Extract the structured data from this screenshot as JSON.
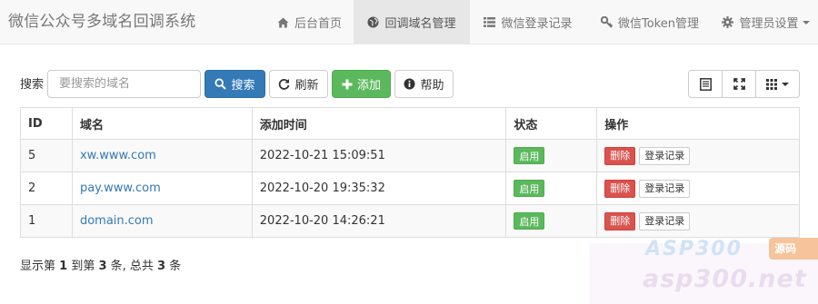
{
  "navbar": {
    "brand": "微信公众号多域名回调系统",
    "items": [
      {
        "label": "后台首页",
        "icon": "home-icon",
        "active": false
      },
      {
        "label": "回调域名管理",
        "icon": "globe-icon",
        "active": true
      },
      {
        "label": "微信登录记录",
        "icon": "list-icon",
        "active": false
      },
      {
        "label": "微信Token管理",
        "icon": "key-icon",
        "active": false
      },
      {
        "label": "管理员设置",
        "icon": "gear-icon",
        "active": false,
        "dropdown": true
      }
    ]
  },
  "toolbar": {
    "search_label": "搜索",
    "search_placeholder": "要搜索的域名",
    "search_value": "",
    "search_button": "搜索",
    "refresh_button": "刷新",
    "add_button": "添加",
    "help_button": "帮助",
    "view_buttons": [
      "list-view-icon",
      "fullscreen-icon",
      "columns-grid-icon"
    ]
  },
  "table": {
    "columns": [
      "ID",
      "域名",
      "添加时间",
      "状态",
      "操作"
    ],
    "rows": [
      {
        "id": "5",
        "domain": "xw.www.com",
        "added": "2022-10-21 15:09:51",
        "status": "启用",
        "delete": "删除",
        "log": "登录记录"
      },
      {
        "id": "2",
        "domain": "pay.www.com",
        "added": "2022-10-20 19:35:32",
        "status": "启用",
        "delete": "删除",
        "log": "登录记录"
      },
      {
        "id": "1",
        "domain": "domain.com",
        "added": "2022-10-20 14:26:21",
        "status": "启用",
        "delete": "删除",
        "log": "登录记录"
      }
    ]
  },
  "pagination": {
    "prefix": "显示第 ",
    "from": "1",
    "mid": " 到第 ",
    "to": "3",
    "mid2": " 条, 总共 ",
    "total": "3",
    "suffix": " 条"
  },
  "watermark": {
    "top_text": "ASP300",
    "bottom_text": "asp300.net",
    "badge_text": "源码"
  },
  "colors": {
    "primary": "#337ab7",
    "success": "#5cb85c",
    "danger": "#d9534f",
    "navbar_bg": "#f8f8f8",
    "nav_active_bg": "#e7e7e7"
  }
}
